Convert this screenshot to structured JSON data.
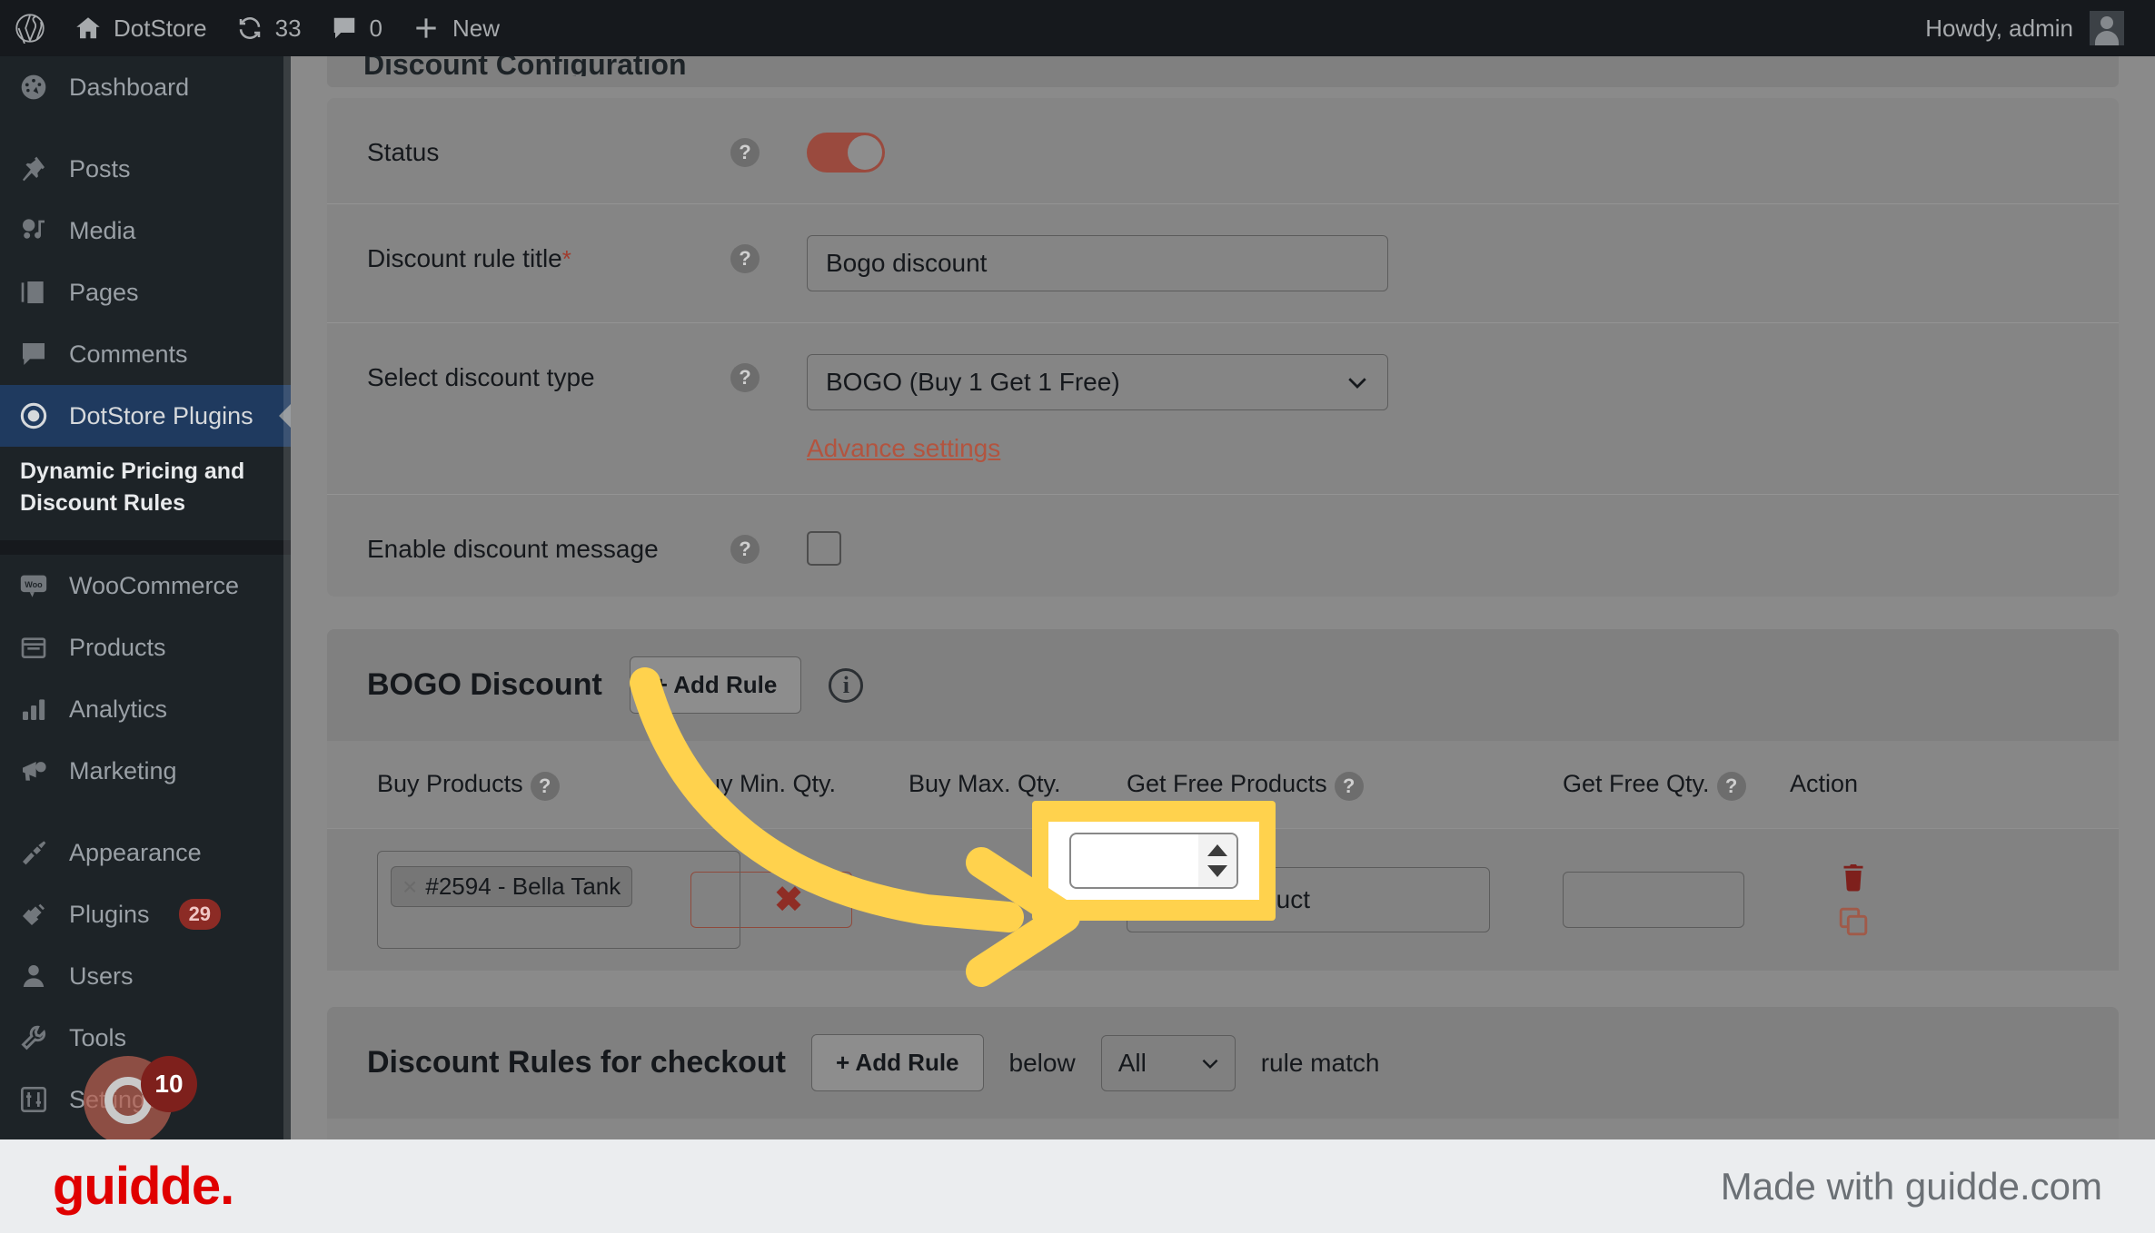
{
  "adminbar": {
    "wp_logo": "wordpress-logo-icon",
    "site_name": "DotStore",
    "updates_count": "33",
    "comments_count": "0",
    "new_label": "New",
    "greeting": "Howdy, admin"
  },
  "sidebar": {
    "items": [
      {
        "label": "Dashboard",
        "icon": "dashboard-icon",
        "current": false
      },
      {
        "label": "Posts",
        "icon": "pin-icon",
        "current": false,
        "gap": true
      },
      {
        "label": "Media",
        "icon": "media-icon",
        "current": false
      },
      {
        "label": "Pages",
        "icon": "pages-icon",
        "current": false
      },
      {
        "label": "Comments",
        "icon": "comments-icon",
        "current": false
      },
      {
        "label": "DotStore Plugins",
        "icon": "dotstore-icon",
        "current": true
      },
      {
        "label": "WooCommerce",
        "icon": "woo-icon",
        "current": false,
        "gap": true
      },
      {
        "label": "Products",
        "icon": "products-icon",
        "current": false
      },
      {
        "label": "Analytics",
        "icon": "analytics-icon",
        "current": false
      },
      {
        "label": "Marketing",
        "icon": "marketing-icon",
        "current": false
      },
      {
        "label": "Appearance",
        "icon": "appearance-icon",
        "current": false,
        "gap": true
      },
      {
        "label": "Plugins",
        "icon": "plugins-icon",
        "current": false,
        "badge": "29"
      },
      {
        "label": "Users",
        "icon": "users-icon",
        "current": false
      },
      {
        "label": "Tools",
        "icon": "tools-icon",
        "current": false
      },
      {
        "label": "Settings",
        "icon": "settings-icon",
        "current": false
      }
    ],
    "submenu_label": "Dynamic Pricing and Discount Rules"
  },
  "page": {
    "cut_heading": "Discount Configuration"
  },
  "form": {
    "status": {
      "label": "Status",
      "help": "?",
      "toggle_on": true
    },
    "rule_title": {
      "label": "Discount rule title",
      "required_mark": "*",
      "help": "?",
      "value": "Bogo discount"
    },
    "discount_type": {
      "label": "Select discount type",
      "help": "?",
      "value": "BOGO (Buy 1 Get 1 Free)",
      "advance_link": "Advance settings"
    },
    "enable_message": {
      "label": "Enable discount message",
      "help": "?",
      "checked": false
    }
  },
  "bogo": {
    "title": "BOGO Discount",
    "add_rule_label": "+ Add Rule",
    "info_icon": "info-icon",
    "columns": [
      {
        "label": "Buy Products",
        "help": "?"
      },
      {
        "label": "Buy Min. Qty.",
        "help": ""
      },
      {
        "label": "Buy Max. Qty.",
        "help": ""
      },
      {
        "label": "Get Free Products",
        "help": "?"
      },
      {
        "label": "Get Free Qty.",
        "help": "?"
      },
      {
        "label": "Action",
        "help": ""
      }
    ],
    "row": {
      "buy_product_chip": "#2594 - Bella Tank",
      "chip_remove": "×",
      "clear_all": "✖",
      "buy_min_qty": "",
      "buy_max_qty": "",
      "get_free_products_placeholder": "Select product",
      "get_free_qty": "",
      "delete_icon": "trash-icon",
      "duplicate_icon": "copy-icon"
    }
  },
  "checkout": {
    "title": "Discount Rules for checkout",
    "add_rule_label": "+ Add Rule",
    "below_label": "below",
    "match_select_value": "All",
    "rule_match_label": "rule match"
  },
  "footer": {
    "logo_text": "guidde.",
    "made_with": "Made with guidde.com"
  },
  "recording": {
    "badge_count": "10"
  },
  "colors": {
    "accent_red": "#b3543f",
    "highlight_yellow": "#ffd24d",
    "wp_dark": "#1d2327",
    "current_menu": "#1f3a5f"
  }
}
